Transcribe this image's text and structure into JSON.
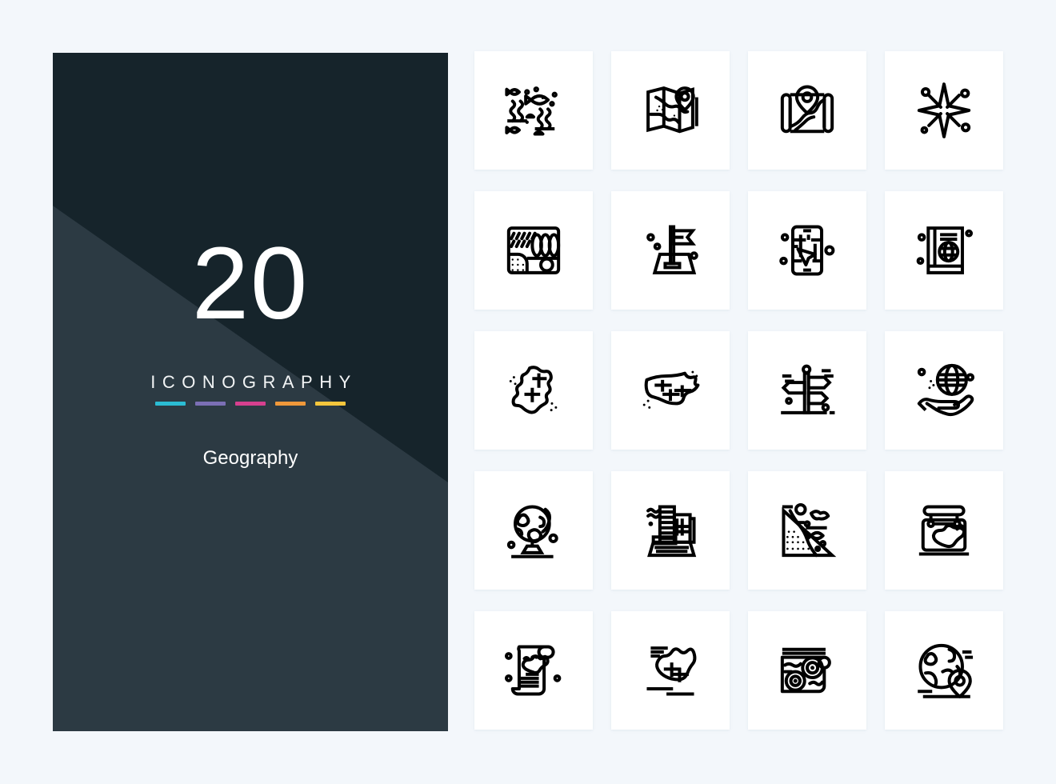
{
  "background_color": "#f3f7fb",
  "cover": {
    "background_color": "#2c3a43",
    "count": "20",
    "heading": "ICONOGRAPHY",
    "subject": "Geography",
    "accent_bars": [
      {
        "name": "cyan",
        "color": "#2bbcd4"
      },
      {
        "name": "purple",
        "color": "#7b6fb5"
      },
      {
        "name": "pink",
        "color": "#d6408f"
      },
      {
        "name": "orange",
        "color": "#f0983a"
      },
      {
        "name": "yellow",
        "color": "#f5c63c"
      }
    ]
  },
  "grid": {
    "columns": 4,
    "rows": 5,
    "card_color": "#ffffff",
    "stroke_color": "#000000",
    "icons": [
      {
        "index": 1,
        "name": "aquarium-fish-seaweed-icon",
        "label": "Marine Life"
      },
      {
        "index": 2,
        "name": "folded-map-pin-icon",
        "label": "Map Location"
      },
      {
        "index": 3,
        "name": "scroll-map-pin-icon",
        "label": "Map Pin"
      },
      {
        "index": 4,
        "name": "compass-rose-star-icon",
        "label": "Compass Rose"
      },
      {
        "index": 5,
        "name": "climate-terrain-map-icon",
        "label": "Climate Map"
      },
      {
        "index": 6,
        "name": "flag-territory-icon",
        "label": "Territory Flag"
      },
      {
        "index": 7,
        "name": "smartphone-gps-navigation-icon",
        "label": "GPS Navigation"
      },
      {
        "index": 8,
        "name": "passport-globe-book-icon",
        "label": "Atlas Book"
      },
      {
        "index": 9,
        "name": "ireland-map-icon",
        "label": "Ireland Map"
      },
      {
        "index": 10,
        "name": "usa-map-icon",
        "label": "USA Map"
      },
      {
        "index": 11,
        "name": "signpost-directions-icon",
        "label": "Signpost"
      },
      {
        "index": 12,
        "name": "globe-in-hand-icon",
        "label": "Globe in Hand"
      },
      {
        "index": 13,
        "name": "desk-globe-icon",
        "label": "Desk Globe"
      },
      {
        "index": 14,
        "name": "city-buildings-icon",
        "label": "City"
      },
      {
        "index": 15,
        "name": "coastline-ocean-icon",
        "label": "Coastline"
      },
      {
        "index": 16,
        "name": "hanging-australia-map-sign-icon",
        "label": "Map Sign"
      },
      {
        "index": 17,
        "name": "parchment-scroll-map-icon",
        "label": "Map Scroll"
      },
      {
        "index": 18,
        "name": "australia-map-icon",
        "label": "Australia Map"
      },
      {
        "index": 19,
        "name": "topographic-contour-map-icon",
        "label": "Topographic Map"
      },
      {
        "index": 20,
        "name": "globe-location-pin-icon",
        "label": "Globe Pin"
      }
    ]
  }
}
